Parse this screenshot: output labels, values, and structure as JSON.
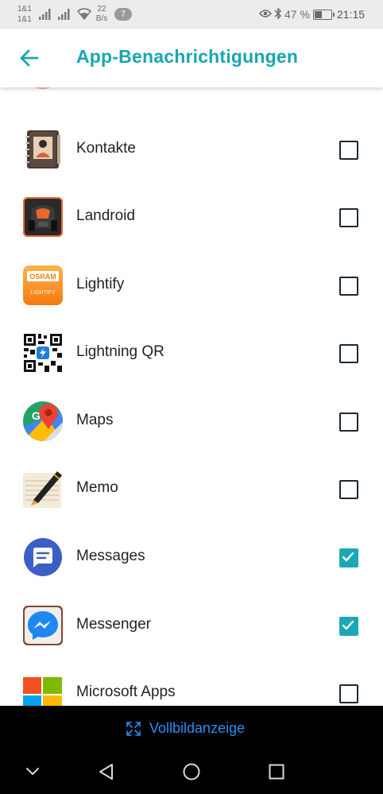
{
  "status_bar": {
    "carrier_1": "1&1",
    "carrier_2": "1&1",
    "net_speed_value": "22",
    "net_speed_unit": "B/s",
    "notification_count": "7",
    "battery_percent": "47 %",
    "battery_level": 0.47,
    "time": "21:15"
  },
  "app_bar": {
    "title": "App-Benachrichtigungen"
  },
  "apps": [
    {
      "label": "Kontakte",
      "icon": "contacts-icon",
      "checked": false
    },
    {
      "label": "Landroid",
      "icon": "landroid-icon",
      "checked": false
    },
    {
      "label": "Lightify",
      "icon": "lightify-icon",
      "checked": false,
      "icon_text_1": "OSRAM",
      "icon_text_2": "LIGHTIFY"
    },
    {
      "label": "Lightning QR",
      "icon": "qr-code-icon",
      "checked": false
    },
    {
      "label": "Maps",
      "icon": "maps-icon",
      "checked": false,
      "icon_text_1": "G"
    },
    {
      "label": "Memo",
      "icon": "memo-pen-icon",
      "checked": false
    },
    {
      "label": "Messages",
      "icon": "messages-icon",
      "checked": true
    },
    {
      "label": "Messenger",
      "icon": "messenger-icon",
      "checked": true
    },
    {
      "label": "Microsoft Apps",
      "icon": "microsoft-icon",
      "checked": false
    }
  ],
  "fullscreen": {
    "label": "Vollbildanzeige",
    "icon": "fullscreen-icon"
  },
  "colors": {
    "accent": "#19a6b0",
    "checkbox_on": "#1ba8b5",
    "fullscreen_text": "#2f8df0"
  }
}
